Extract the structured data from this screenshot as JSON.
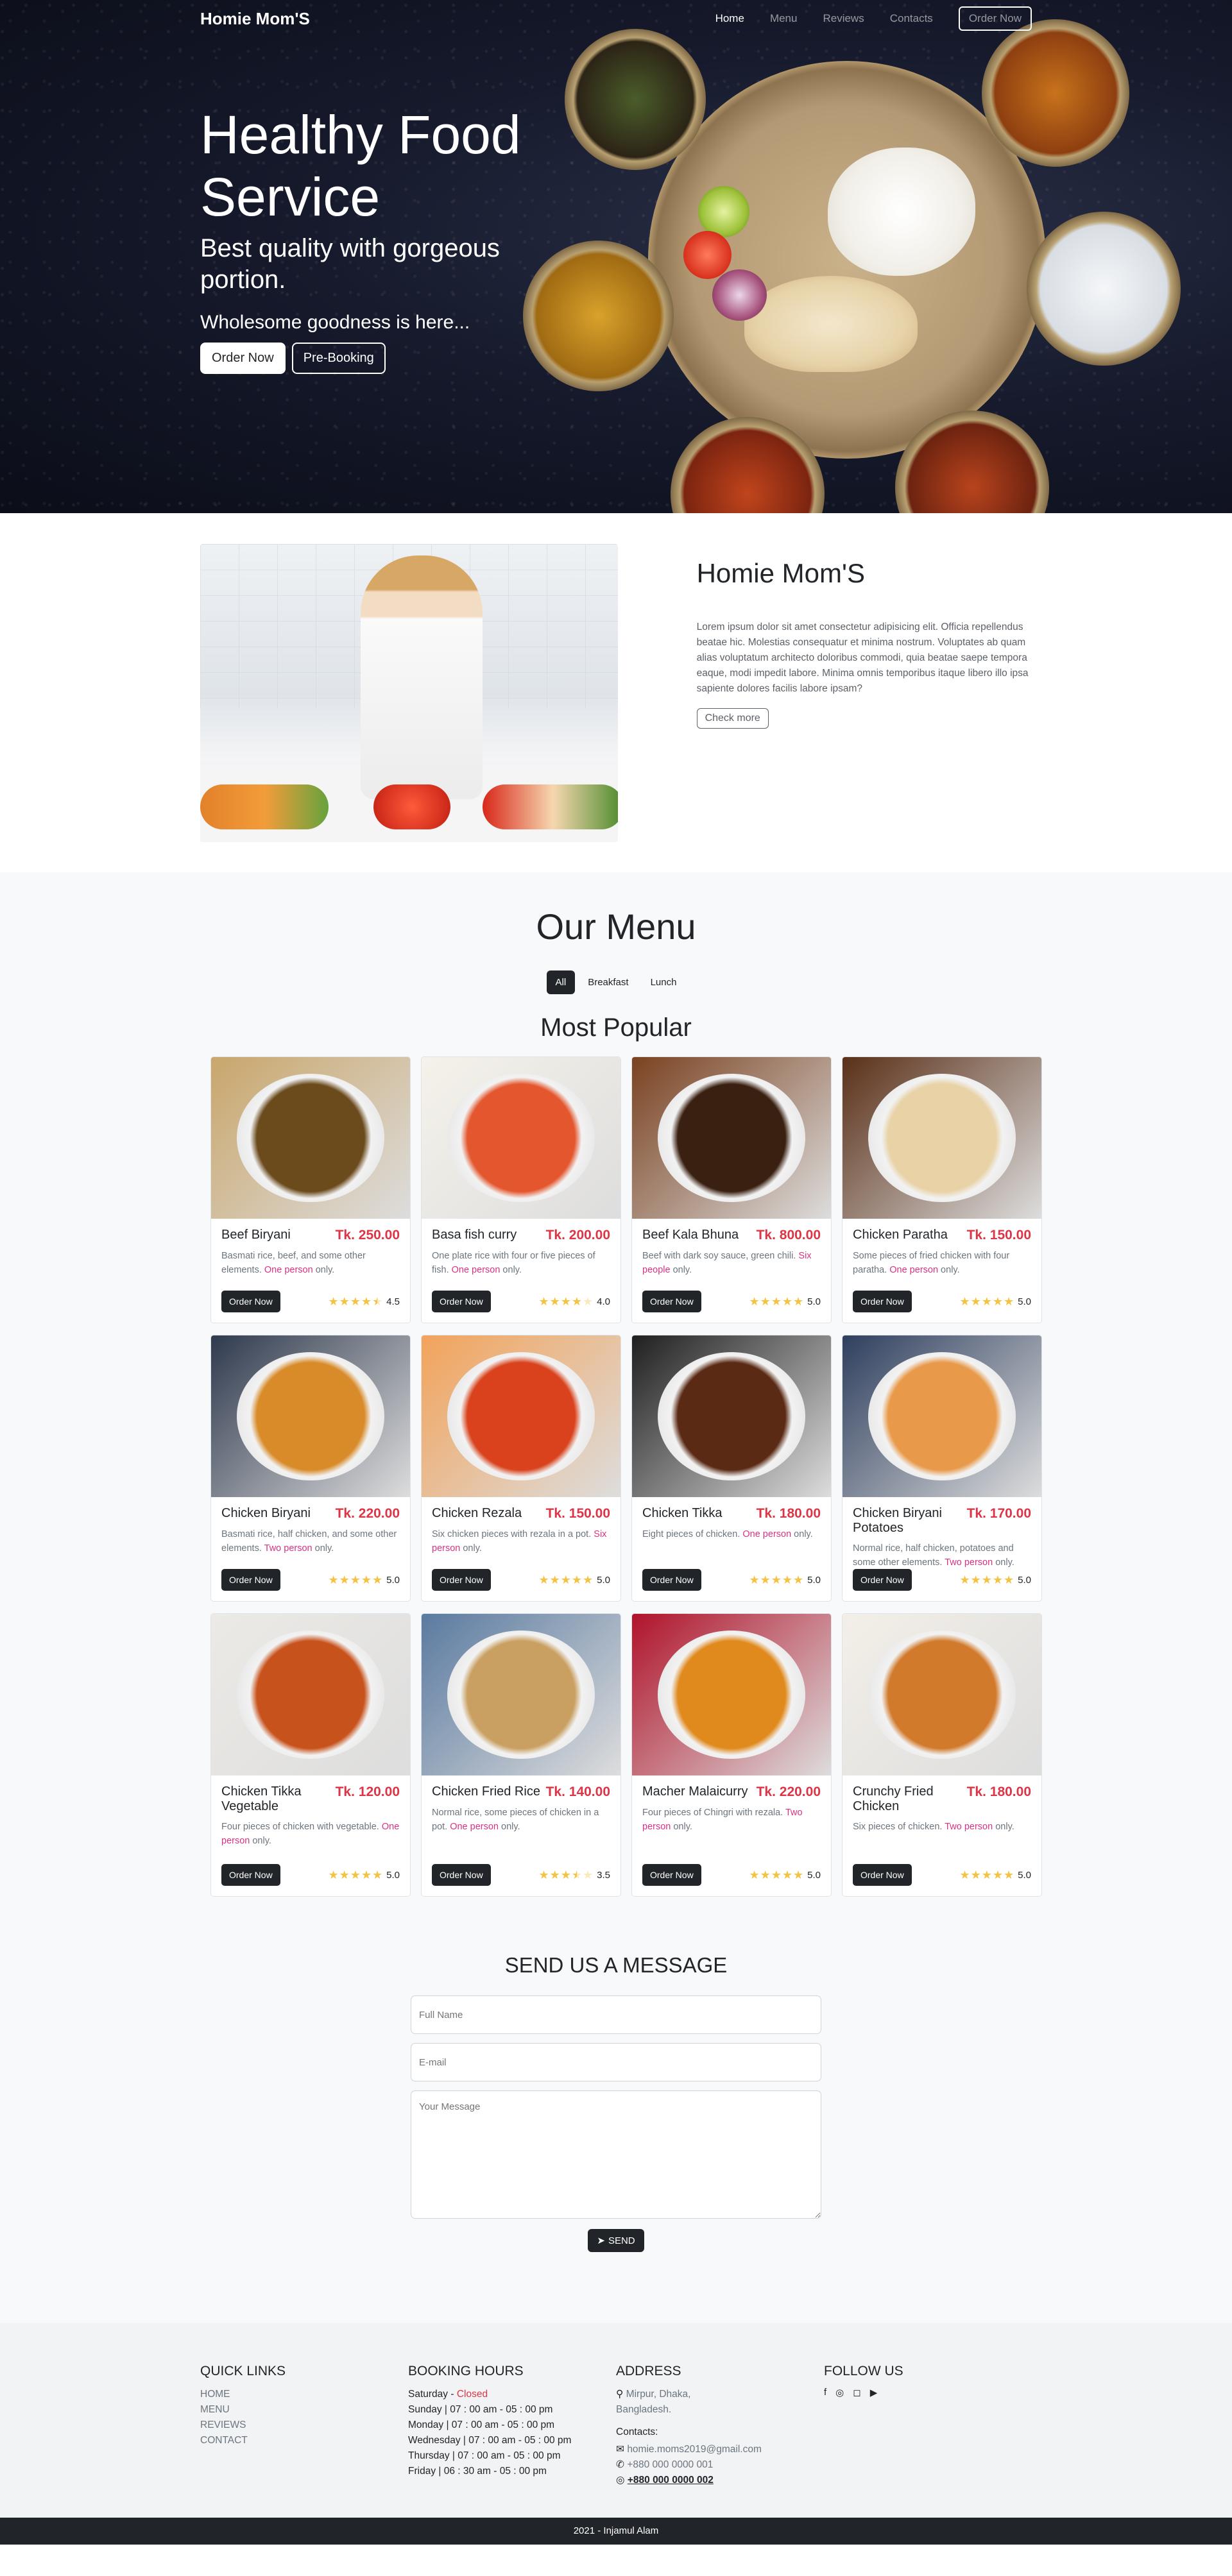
{
  "nav": {
    "brand": "Homie Mom'S",
    "links": [
      "Home",
      "Menu",
      "Reviews",
      "Contacts"
    ],
    "cta": "Order Now"
  },
  "hero": {
    "title": "Healthy Food Service",
    "subtitle": "Best quality with gorgeous portion.",
    "tagline": "Wholesome goodness is here...",
    "primary_button": "Order Now",
    "secondary_button": "Pre-Booking"
  },
  "about": {
    "title": "Homie Mom'S",
    "body": "Lorem ipsum dolor sit amet consectetur adipisicing elit. Officia repellendus beatae hic. Molestias consequatur et minima nostrum. Voluptates ab quam alias voluptatum architecto doloribus commodi, quia beatae saepe tempora eaque, modi impedit labore. Minima omnis temporibus itaque libero illo ipsa sapiente dolores facilis labore ipsam?",
    "button": "Check more"
  },
  "menu": {
    "title": "Our Menu",
    "filters": [
      "All",
      "Breakfast",
      "Lunch"
    ],
    "section_title": "Most Popular",
    "order_label": "Order Now",
    "items": [
      {
        "name": "Beef Biryani",
        "price": "Tk. 250.00",
        "desc": "Basmati rice, beef, and some other elements.",
        "serves": "One person",
        "rating": 4.5,
        "rating_text": "4.5",
        "palette": [
          "#6b4a1c",
          "#c9a66b"
        ]
      },
      {
        "name": "Basa fish curry",
        "price": "Tk. 200.00",
        "desc": "One plate rice with four or five pieces of fish.",
        "serves": "One person",
        "rating": 4.0,
        "rating_text": "4.0",
        "palette": [
          "#e4572e",
          "#f5f2ea"
        ]
      },
      {
        "name": "Beef Kala Bhuna",
        "price": "Tk. 800.00",
        "desc": "Beef with dark soy sauce, green chili.",
        "serves": "Six people",
        "rating": 5.0,
        "rating_text": "5.0",
        "palette": [
          "#3a2010",
          "#7a4220"
        ]
      },
      {
        "name": "Chicken Paratha",
        "price": "Tk. 150.00",
        "desc": "Some pieces of fried chicken with four paratha.",
        "serves": "One person",
        "rating": 5.0,
        "rating_text": "5.0",
        "palette": [
          "#e8d2a6",
          "#5a3018"
        ]
      },
      {
        "name": "Chicken Biryani",
        "price": "Tk. 220.00",
        "desc": "Basmati rice, half chicken, and some other elements.",
        "serves": "Two person",
        "rating": 5.0,
        "rating_text": "5.0",
        "palette": [
          "#d98b2a",
          "#2f3a4e"
        ]
      },
      {
        "name": "Chicken Rezala",
        "price": "Tk. 150.00",
        "desc": "Six chicken pieces with rezala in a pot.",
        "serves": "Six person",
        "rating": 5.0,
        "rating_text": "5.0",
        "palette": [
          "#d9421c",
          "#f2a35a"
        ]
      },
      {
        "name": "Chicken Tikka",
        "price": "Tk. 180.00",
        "desc": "Eight pieces of chicken.",
        "serves": "One person",
        "rating": 5.0,
        "rating_text": "5.0",
        "palette": [
          "#5a2a14",
          "#1f1f1f"
        ]
      },
      {
        "name": "Chicken Biryani Potatoes",
        "price": "Tk. 170.00",
        "desc": "Normal rice, half chicken, potatoes and some other elements.",
        "serves": "Two person",
        "rating": 5.0,
        "rating_text": "5.0",
        "palette": [
          "#e89a4a",
          "#2e3f5e"
        ]
      },
      {
        "name": "Chicken Tikka Vegetable",
        "price": "Tk. 120.00",
        "desc": "Four pieces of chicken with vegetable.",
        "serves": "One person",
        "rating": 5.0,
        "rating_text": "5.0",
        "palette": [
          "#c8521c",
          "#eceae6"
        ]
      },
      {
        "name": "Chicken Fried Rice",
        "price": "Tk. 140.00",
        "desc": "Normal rice, some pieces of chicken in a pot.",
        "serves": "One person",
        "rating": 3.5,
        "rating_text": "3.5",
        "palette": [
          "#c9a062",
          "#5a7aa0"
        ]
      },
      {
        "name": "Macher Malaicurry",
        "price": "Tk. 220.00",
        "desc": "Four pieces of Chingri with rezala.",
        "serves": "Two person",
        "rating": 5.0,
        "rating_text": "5.0",
        "palette": [
          "#e08a1e",
          "#b0132a"
        ]
      },
      {
        "name": "Crunchy Fried Chicken",
        "price": "Tk. 180.00",
        "desc": "Six pieces of chicken.",
        "serves": "Two person",
        "rating": 5.0,
        "rating_text": "5.0",
        "palette": [
          "#d27a2c",
          "#f3efe8"
        ]
      }
    ]
  },
  "contact": {
    "title": "SEND US A MESSAGE",
    "name_placeholder": "Full Name",
    "email_placeholder": "E-mail",
    "message_placeholder": "Your Message",
    "send_label": "SEND"
  },
  "footer": {
    "quick_links_title": "QUICK LINKS",
    "quick_links": [
      "HOME",
      "MENU",
      "REVIEWS",
      "CONTACT"
    ],
    "booking_title": "BOOKING HOURS",
    "booking_saturday_day": "Saturday - ",
    "booking_saturday_status": "Closed",
    "booking_hours": [
      "Sunday | 07 : 00 am - 05 : 00 pm",
      "Monday | 07 : 00 am - 05 : 00 pm",
      "Wednesday | 07 : 00 am - 05 : 00 pm",
      "Thursday | 07 : 00 am - 05 : 00 pm",
      "Friday | 06 : 30 am - 05 : 00 pm"
    ],
    "address_title": "ADDRESS",
    "address": "Mirpur, Dhaka, Bangladesh.",
    "contacts_label": "Contacts:",
    "email": "homie.moms2019@gmail.com",
    "phone": "+880 000 0000 001",
    "whatsapp": "+880 000 0000 002",
    "follow_title": "FOLLOW US",
    "copyright": "2021 - Injamul Alam"
  }
}
